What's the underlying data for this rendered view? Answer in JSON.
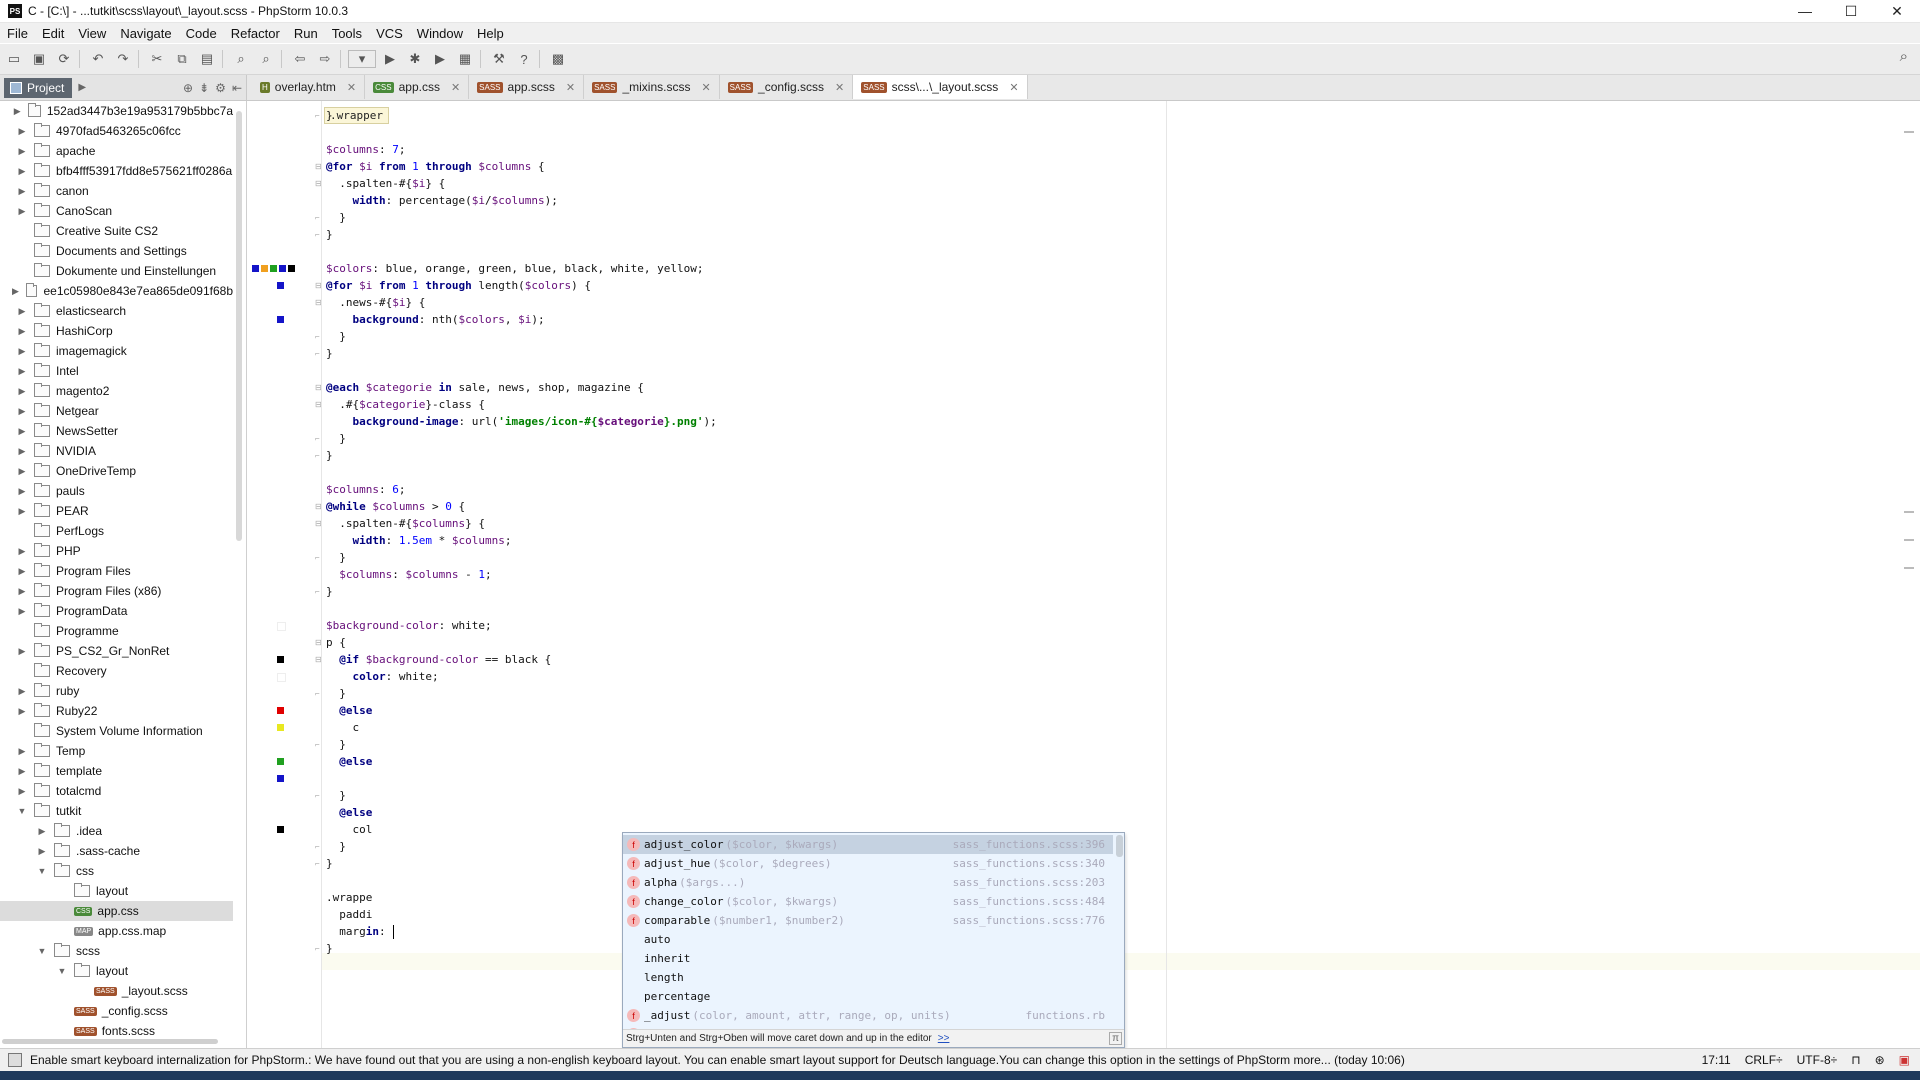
{
  "window": {
    "title": "C - [C:\\] - ...tutkit\\scss\\layout\\_layout.scss - PhpStorm 10.0.3",
    "app_icon": "PS",
    "controls": [
      "—",
      "☐",
      "✕"
    ]
  },
  "menu": [
    "File",
    "Edit",
    "View",
    "Navigate",
    "Code",
    "Refactor",
    "Run",
    "Tools",
    "VCS",
    "Window",
    "Help"
  ],
  "toolbar": {
    "icons": [
      "open-icon",
      "save-icon",
      "sync-icon",
      "undo-icon",
      "redo-icon",
      "cut-icon",
      "copy-icon",
      "paste-icon",
      "find-icon",
      "replace-icon",
      "back-icon",
      "forward-icon",
      "run-config-dropdown",
      "run-icon",
      "debug-icon",
      "coverage-icon",
      "profile-icon",
      "settings-icon",
      "help-icon",
      "sdk-icon"
    ],
    "search_icon": "search-icon"
  },
  "project_panel": {
    "tab_label": "Project",
    "tree": [
      {
        "label": "152ad3447b3e19a953179b5bbc7a",
        "indent": 0,
        "expanded": false,
        "type": "folder"
      },
      {
        "label": "4970fad5463265c06fcc",
        "indent": 0,
        "expanded": false,
        "type": "folder"
      },
      {
        "label": "apache",
        "indent": 0,
        "expanded": false,
        "type": "folder"
      },
      {
        "label": "bfb4fff53917fdd8e575621ff0286a",
        "indent": 0,
        "expanded": false,
        "type": "folder"
      },
      {
        "label": "canon",
        "indent": 0,
        "expanded": false,
        "type": "folder"
      },
      {
        "label": "CanoScan",
        "indent": 0,
        "expanded": false,
        "type": "folder"
      },
      {
        "label": "Creative Suite CS2",
        "indent": 0,
        "expanded": null,
        "type": "folder"
      },
      {
        "label": "Documents and Settings",
        "indent": 0,
        "expanded": null,
        "type": "folder"
      },
      {
        "label": "Dokumente und Einstellungen",
        "indent": 0,
        "expanded": null,
        "type": "folder"
      },
      {
        "label": "ee1c05980e843e7ea865de091f68b",
        "indent": 0,
        "expanded": false,
        "type": "folder"
      },
      {
        "label": "elasticsearch",
        "indent": 0,
        "expanded": false,
        "type": "folder"
      },
      {
        "label": "HashiCorp",
        "indent": 0,
        "expanded": false,
        "type": "folder"
      },
      {
        "label": "imagemagick",
        "indent": 0,
        "expanded": false,
        "type": "folder"
      },
      {
        "label": "Intel",
        "indent": 0,
        "expanded": false,
        "type": "folder"
      },
      {
        "label": "magento2",
        "indent": 0,
        "expanded": false,
        "type": "folder"
      },
      {
        "label": "Netgear",
        "indent": 0,
        "expanded": false,
        "type": "folder"
      },
      {
        "label": "NewsSetter",
        "indent": 0,
        "expanded": false,
        "type": "folder"
      },
      {
        "label": "NVIDIA",
        "indent": 0,
        "expanded": false,
        "type": "folder"
      },
      {
        "label": "OneDriveTemp",
        "indent": 0,
        "expanded": false,
        "type": "folder"
      },
      {
        "label": "pauls",
        "indent": 0,
        "expanded": false,
        "type": "folder"
      },
      {
        "label": "PEAR",
        "indent": 0,
        "expanded": false,
        "type": "folder"
      },
      {
        "label": "PerfLogs",
        "indent": 0,
        "expanded": null,
        "type": "folder"
      },
      {
        "label": "PHP",
        "indent": 0,
        "expanded": false,
        "type": "folder"
      },
      {
        "label": "Program Files",
        "indent": 0,
        "expanded": false,
        "type": "folder"
      },
      {
        "label": "Program Files (x86)",
        "indent": 0,
        "expanded": false,
        "type": "folder"
      },
      {
        "label": "ProgramData",
        "indent": 0,
        "expanded": false,
        "type": "folder"
      },
      {
        "label": "Programme",
        "indent": 0,
        "expanded": null,
        "type": "folder"
      },
      {
        "label": "PS_CS2_Gr_NonRet",
        "indent": 0,
        "expanded": false,
        "type": "folder"
      },
      {
        "label": "Recovery",
        "indent": 0,
        "expanded": null,
        "type": "folder"
      },
      {
        "label": "ruby",
        "indent": 0,
        "expanded": false,
        "type": "folder"
      },
      {
        "label": "Ruby22",
        "indent": 0,
        "expanded": false,
        "type": "folder"
      },
      {
        "label": "System Volume Information",
        "indent": 0,
        "expanded": null,
        "type": "folder"
      },
      {
        "label": "Temp",
        "indent": 0,
        "expanded": false,
        "type": "folder"
      },
      {
        "label": "template",
        "indent": 0,
        "expanded": false,
        "type": "folder"
      },
      {
        "label": "totalcmd",
        "indent": 0,
        "expanded": false,
        "type": "folder"
      },
      {
        "label": "tutkit",
        "indent": 0,
        "expanded": true,
        "type": "folder"
      },
      {
        "label": ".idea",
        "indent": 1,
        "expanded": false,
        "type": "folder"
      },
      {
        "label": ".sass-cache",
        "indent": 1,
        "expanded": false,
        "type": "folder"
      },
      {
        "label": "css",
        "indent": 1,
        "expanded": true,
        "type": "folder"
      },
      {
        "label": "layout",
        "indent": 2,
        "expanded": null,
        "type": "folder"
      },
      {
        "label": "app.css",
        "indent": 2,
        "expanded": null,
        "type": "css",
        "selected": true
      },
      {
        "label": "app.css.map",
        "indent": 2,
        "expanded": null,
        "type": "file"
      },
      {
        "label": "scss",
        "indent": 1,
        "expanded": true,
        "type": "folder"
      },
      {
        "label": "layout",
        "indent": 2,
        "expanded": true,
        "type": "folder"
      },
      {
        "label": "_layout.scss",
        "indent": 3,
        "expanded": null,
        "type": "sass"
      },
      {
        "label": "_config.scss",
        "indent": 2,
        "expanded": null,
        "type": "sass"
      },
      {
        "label": "fonts.scss",
        "indent": 2,
        "expanded": null,
        "type": "sass"
      }
    ]
  },
  "tabs": [
    {
      "label": "overlay.htm",
      "type": "htm",
      "active": false
    },
    {
      "label": "app.css",
      "type": "css",
      "active": false
    },
    {
      "label": "app.scss",
      "type": "sass",
      "active": false
    },
    {
      "label": "_mixins.scss",
      "type": "sass",
      "active": false
    },
    {
      "label": "_config.scss",
      "type": "sass",
      "active": false
    },
    {
      "label": "scss\\...\\_layout.scss",
      "type": "sass",
      "active": true
    }
  ],
  "editor": {
    "breadcrumb": ".wrapper",
    "lines": [
      "}",
      "",
      "$columns: 7;",
      "@for $i from 1 through $columns {",
      "  .spalten-#{$i} {",
      "    width: percentage($i/$columns);",
      "  }",
      "}",
      "",
      "$colors: blue, orange, green, blue, black, white, yellow;",
      "@for $i from 1 through length($colors) {",
      "  .news-#{$i} {",
      "    background: nth($colors, $i);",
      "  }",
      "}",
      "",
      "@each $categorie in sale, news, shop, magazine {",
      "  .#{$categorie}-class {",
      "    background-image: url('images/icon-#{$categorie}.png');",
      "  }",
      "}",
      "",
      "$columns: 6;",
      "@while $columns > 0 {",
      "  .spalten-#{$columns} {",
      "    width: 1.5em * $columns;",
      "  }",
      "  $columns: $columns - 1;",
      "}",
      "",
      "$background-color: white;",
      "p {",
      "  @if $background-color == black {",
      "    color: white;",
      "  }",
      "  @else",
      "    c",
      "  }",
      "  @else",
      "",
      "  }",
      "  @else",
      "    col",
      "  }",
      "}",
      "",
      ".wrappe",
      "  paddi",
      "  margin: ",
      "}"
    ],
    "swatches": [
      {
        "line": 9,
        "colors": [
          "#1414c8",
          "#f0a020",
          "#20a020",
          "#1414c8",
          "#000000"
        ]
      },
      {
        "line": 10,
        "colors": [
          "#1414c8"
        ]
      },
      {
        "line": 12,
        "colors": [
          "#1414c8"
        ]
      },
      {
        "line": 30,
        "colors": [
          "#ffffff"
        ]
      },
      {
        "line": 32,
        "colors": [
          "#000000"
        ]
      },
      {
        "line": 33,
        "colors": [
          "#ffffff"
        ]
      },
      {
        "line": 35,
        "colors": [
          "#e00000"
        ]
      },
      {
        "line": 36,
        "colors": [
          "#e8e820"
        ]
      },
      {
        "line": 38,
        "colors": [
          "#20a020"
        ]
      },
      {
        "line": 39,
        "colors": [
          "#1414c8"
        ]
      },
      {
        "line": 42,
        "colors": [
          "#000000"
        ]
      }
    ]
  },
  "autocomplete": {
    "items": [
      {
        "name": "adjust_color",
        "sig": "($color, $kwargs)",
        "source": "sass_functions.scss:396",
        "icon": true,
        "selected": true
      },
      {
        "name": "adjust_hue",
        "sig": "($color, $degrees)",
        "source": "sass_functions.scss:340",
        "icon": true
      },
      {
        "name": "alpha",
        "sig": "($args...)",
        "source": "sass_functions.scss:203",
        "icon": true
      },
      {
        "name": "change_color",
        "sig": "($color, $kwargs)",
        "source": "sass_functions.scss:484",
        "icon": true
      },
      {
        "name": "comparable",
        "sig": "($number1, $number2)",
        "source": "sass_functions.scss:776",
        "icon": true
      },
      {
        "name": "auto",
        "sig": "",
        "source": "",
        "icon": false
      },
      {
        "name": "inherit",
        "sig": "",
        "source": "",
        "icon": false
      },
      {
        "name": "length",
        "sig": "",
        "source": "",
        "icon": false
      },
      {
        "name": "percentage",
        "sig": "",
        "source": "",
        "icon": false
      },
      {
        "name": "_adjust",
        "sig": "(color, amount, attr, range, op, units)",
        "source": "functions.rb",
        "icon": true
      },
      {
        "name": "_adjust",
        "sig": "",
        "source": "functions.rb",
        "icon": true
      }
    ],
    "footer": "Strg+Unten and Strg+Oben will move caret down and up in the editor",
    "footer_link": ">>",
    "pi_label": "π"
  },
  "statusbar": {
    "message": "Enable smart keyboard internalization for PhpStorm.: We have found out that you are using a non-english keyboard layout. You can enable smart layout support for Deutsch language.You can change this option in the settings of PhpStorm more... (today 10:06)",
    "position": "17:11",
    "line_sep": "CRLF÷",
    "encoding": "UTF-8÷"
  }
}
